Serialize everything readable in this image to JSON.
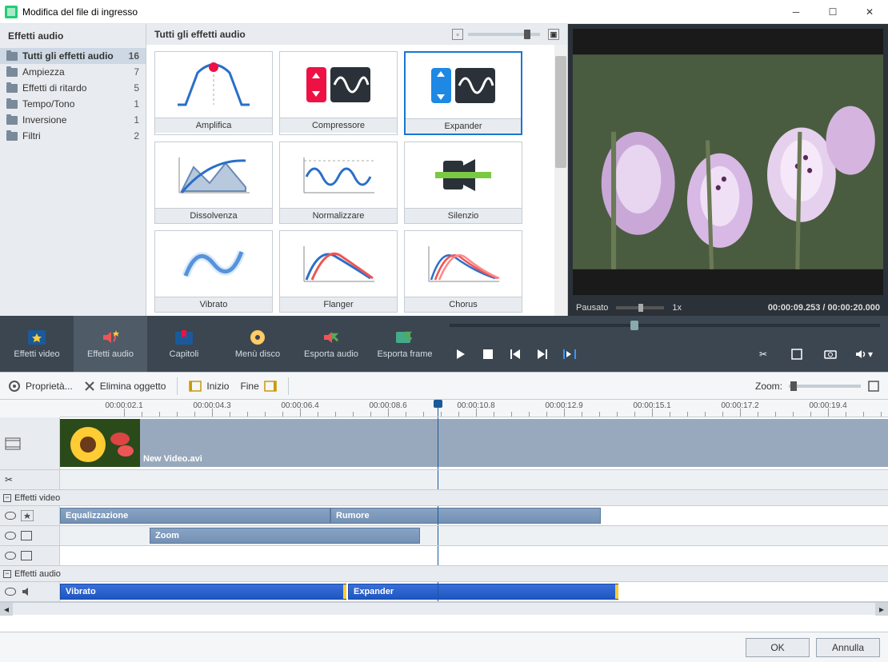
{
  "window": {
    "title": "Modifica del file di ingresso"
  },
  "sidebar": {
    "header": "Effetti audio",
    "items": [
      {
        "label": "Tutti gli effetti audio",
        "count": "16"
      },
      {
        "label": "Ampiezza",
        "count": "7"
      },
      {
        "label": "Effetti di ritardo",
        "count": "5"
      },
      {
        "label": "Tempo/Tono",
        "count": "1"
      },
      {
        "label": "Inversione",
        "count": "1"
      },
      {
        "label": "Filtri",
        "count": "2"
      }
    ]
  },
  "gallery": {
    "header": "Tutti gli effetti audio",
    "effects": [
      "Amplifica",
      "Compressore",
      "Expander",
      "Dissolvenza",
      "Normalizzare",
      "Silenzio",
      "Vibrato",
      "Flanger",
      "Chorus"
    ]
  },
  "preview": {
    "status": "Pausato",
    "speed": "1x",
    "time_current": "00:00:09.253",
    "time_total": "00:00:20.000"
  },
  "tooltabs": {
    "video_effects": "Effetti video",
    "audio_effects": "Effetti audio",
    "chapters": "Capitoli",
    "disc_menu": "Menù disco",
    "export_audio": "Esporta audio",
    "export_frame": "Esporta frame"
  },
  "options": {
    "properties": "Proprietà...",
    "delete_object": "Elimina oggetto",
    "start": "Inizio",
    "end": "Fine",
    "zoom_label": "Zoom:"
  },
  "timeline": {
    "ruler": [
      "00:00:02.1",
      "00:00:04.3",
      "00:00:06.4",
      "00:00:08.6",
      "00:00:10.8",
      "00:00:12.9",
      "00:00:15.1",
      "00:00:17.2",
      "00:00:19.4"
    ],
    "video_clip": "New Video.avi",
    "section_video": "Effetti video",
    "section_audio": "Effetti audio",
    "clips": {
      "equalizzazione": "Equalizzazione",
      "rumore": "Rumore",
      "zoom": "Zoom",
      "vibrato": "Vibrato",
      "expander": "Expander"
    }
  },
  "bottom": {
    "ok": "OK",
    "cancel": "Annulla"
  }
}
